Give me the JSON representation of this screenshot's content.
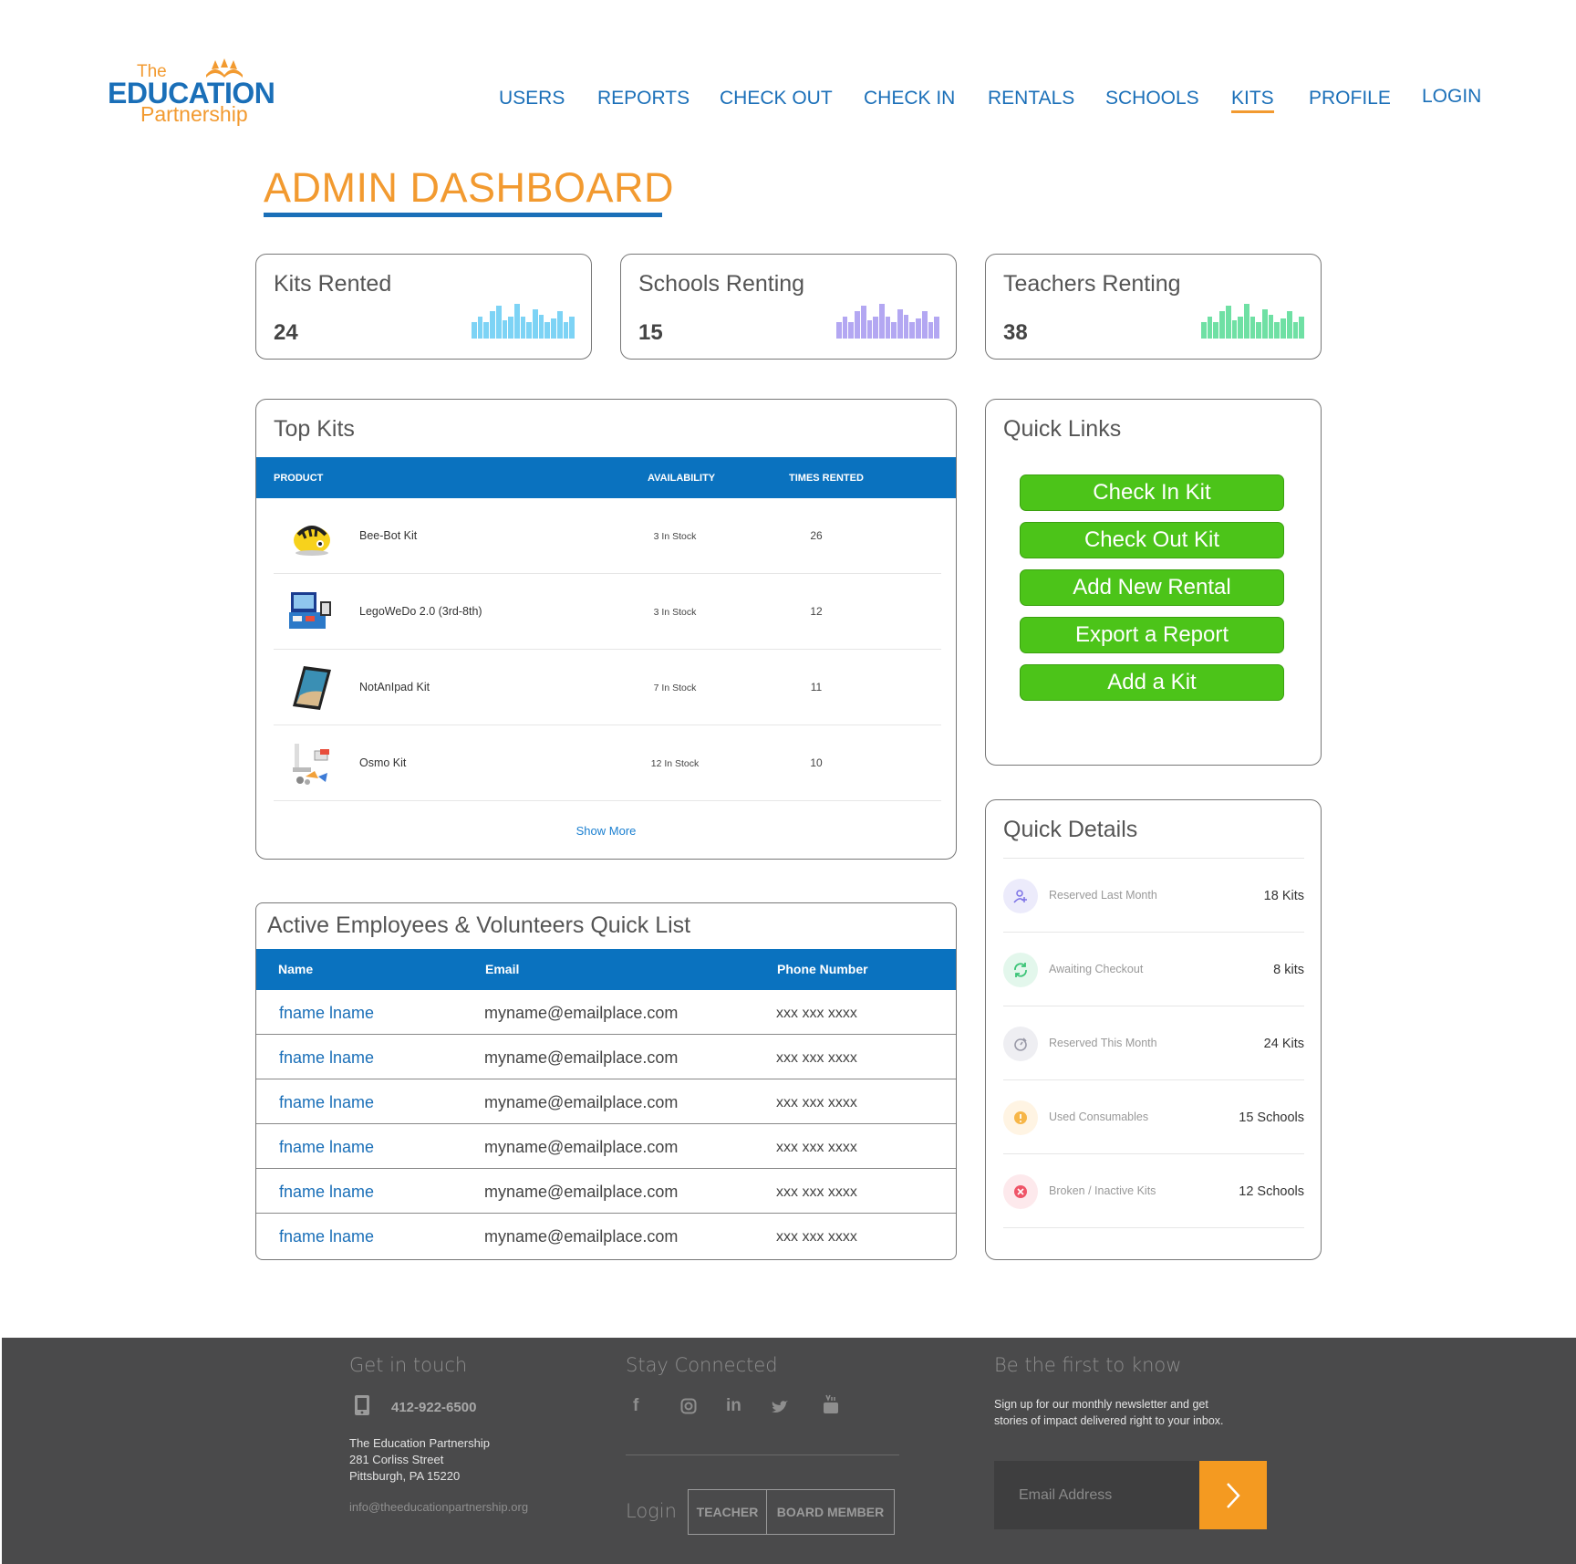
{
  "logo": {
    "top": "The",
    "main": "EDUCATION",
    "bottom": "Partnership"
  },
  "nav": [
    {
      "label": "USERS"
    },
    {
      "label": "REPORTS"
    },
    {
      "label": "CHECK OUT"
    },
    {
      "label": "CHECK IN"
    },
    {
      "label": "RENTALS"
    },
    {
      "label": "SCHOOLS"
    },
    {
      "label": "KITS",
      "active": true
    },
    {
      "label": "PROFILE"
    },
    {
      "label": "LOGIN"
    }
  ],
  "page_title": "ADMIN DASHBOARD",
  "stats": [
    {
      "label": "Kits Rented",
      "value": "24",
      "color": "#7dd3f5",
      "bars": [
        0.45,
        0.6,
        0.45,
        0.75,
        0.9,
        0.5,
        0.6,
        0.95,
        0.6,
        0.45,
        0.8,
        0.65,
        0.45,
        0.55,
        0.75,
        0.45,
        0.6
      ]
    },
    {
      "label": "Schools Renting",
      "value": "15",
      "color": "#b3a7f2",
      "bars": [
        0.45,
        0.6,
        0.45,
        0.75,
        0.9,
        0.5,
        0.6,
        0.95,
        0.6,
        0.45,
        0.8,
        0.65,
        0.45,
        0.55,
        0.75,
        0.45,
        0.6
      ]
    },
    {
      "label": "Teachers Renting",
      "value": "38",
      "color": "#6fe0a4",
      "bars": [
        0.45,
        0.6,
        0.45,
        0.75,
        0.9,
        0.5,
        0.6,
        0.95,
        0.6,
        0.45,
        0.8,
        0.65,
        0.45,
        0.55,
        0.75,
        0.45,
        0.6
      ]
    }
  ],
  "top_kits": {
    "title": "Top Kits",
    "headers": {
      "product": "PRODUCT",
      "availability": "AVAILABILITY",
      "times": "TIMES RENTED"
    },
    "rows": [
      {
        "name": "Bee-Bot Kit",
        "availability": "3 In Stock",
        "times": "26",
        "icon": "bee-bot-icon"
      },
      {
        "name": "LegoWeDo 2.0 (3rd-8th)",
        "availability": "3 In Stock",
        "times": "12",
        "icon": "lego-kit-icon"
      },
      {
        "name": "NotAnIpad Kit",
        "availability": "7 In Stock",
        "times": "11",
        "icon": "tablet-icon"
      },
      {
        "name": "Osmo Kit",
        "availability": "12 In Stock",
        "times": "10",
        "icon": "osmo-kit-icon"
      }
    ],
    "show_more": "Show More"
  },
  "employees": {
    "title": "Active Employees & Volunteers Quick List",
    "headers": {
      "name": "Name",
      "email": "Email",
      "phone": "Phone Number"
    },
    "rows": [
      {
        "name": "fname lname",
        "email": "myname@emailplace.com",
        "phone": "xxx xxx xxxx"
      },
      {
        "name": "fname lname",
        "email": "myname@emailplace.com",
        "phone": "xxx xxx xxxx"
      },
      {
        "name": "fname lname",
        "email": "myname@emailplace.com",
        "phone": "xxx xxx xxxx"
      },
      {
        "name": "fname lname",
        "email": "myname@emailplace.com",
        "phone": "xxx xxx xxxx"
      },
      {
        "name": "fname lname",
        "email": "myname@emailplace.com",
        "phone": "xxx xxx xxxx"
      },
      {
        "name": "fname lname",
        "email": "myname@emailplace.com",
        "phone": "xxx xxx xxxx"
      }
    ]
  },
  "quick_links": {
    "title": "Quick Links",
    "buttons": [
      "Check In Kit",
      "Check Out Kit",
      "Add New Rental",
      "Export a Report",
      "Add a Kit"
    ],
    "color": "#4cc419"
  },
  "quick_details": {
    "title": "Quick Details",
    "rows": [
      {
        "label": "Reserved Last Month",
        "value": "18 Kits",
        "icon": "add-user-icon",
        "bg": "#ecebfb",
        "fg": "#7c72e6"
      },
      {
        "label": "Awaiting Checkout",
        "value": "8 kits",
        "icon": "refresh-icon",
        "bg": "#e3f7ec",
        "fg": "#3cc477"
      },
      {
        "label": "Reserved This Month",
        "value": "24 Kits",
        "icon": "timer-icon",
        "bg": "#eeeef2",
        "fg": "#9a9aa8"
      },
      {
        "label": "Used Consumables",
        "value": "15 Schools",
        "icon": "alert-icon",
        "bg": "#fff4e3",
        "fg": "#f7b648"
      },
      {
        "label": "Broken / Inactive Kits",
        "value": "12 Schools",
        "icon": "close-circle-icon",
        "bg": "#fde9ec",
        "fg": "#ef5568"
      }
    ]
  },
  "footer": {
    "contact": {
      "heading": "Get in touch",
      "phone": "412-922-6500",
      "address": [
        "The Education Partnership",
        "281 Corliss Street",
        "Pittsburgh, PA 15220"
      ],
      "email": "info@theeducationpartnership.org"
    },
    "social": {
      "heading": "Stay Connected",
      "icons": [
        "facebook-icon",
        "instagram-icon",
        "linkedin-icon",
        "twitter-icon",
        "youtube-icon"
      ]
    },
    "login": {
      "label": "Login",
      "teacher": "TEACHER",
      "board": "BOARD MEMBER"
    },
    "newsletter": {
      "heading": "Be the first to know",
      "text": [
        "Sign up for our monthly newsletter and get",
        "stories of impact delivered right to your inbox."
      ],
      "placeholder": "Email Address"
    }
  }
}
